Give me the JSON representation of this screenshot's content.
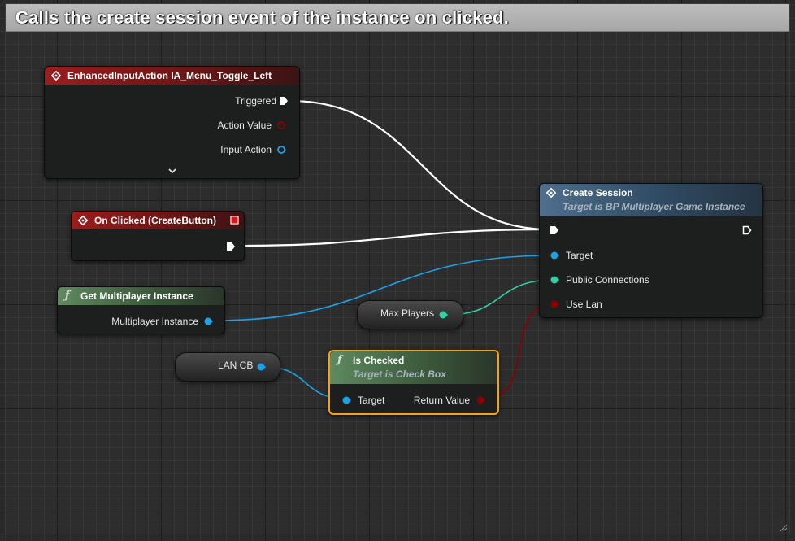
{
  "comment": {
    "text": "Calls the create session event of the instance on clicked."
  },
  "colors": {
    "exec": "#ffffff",
    "object": "#1ca0e6",
    "integer": "#2fd1a4",
    "boolean": "#8b0000"
  },
  "nodes": {
    "enhanced_input": {
      "title": "EnhancedInputAction IA_Menu_Toggle_Left",
      "pins": {
        "triggered": "Triggered",
        "action_value": "Action Value",
        "input_action": "Input Action"
      },
      "expand_icon": "chevron-down-icon"
    },
    "on_clicked": {
      "title": "On Clicked (CreateButton)"
    },
    "get_instance": {
      "title": "Get Multiplayer Instance",
      "pins": {
        "out": "Multiplayer Instance"
      }
    },
    "create_session": {
      "title": "Create Session",
      "subtitle": "Target is BP Multiplayer Game Instance",
      "pins": {
        "target": "Target",
        "public_connections": "Public Connections",
        "use_lan": "Use Lan"
      }
    },
    "max_players": {
      "label": "Max Players"
    },
    "lan_cb": {
      "label": "LAN CB"
    },
    "is_checked": {
      "title": "Is Checked",
      "subtitle": "Target is Check Box",
      "pins": {
        "target": "Target",
        "return_value": "Return Value"
      }
    }
  }
}
